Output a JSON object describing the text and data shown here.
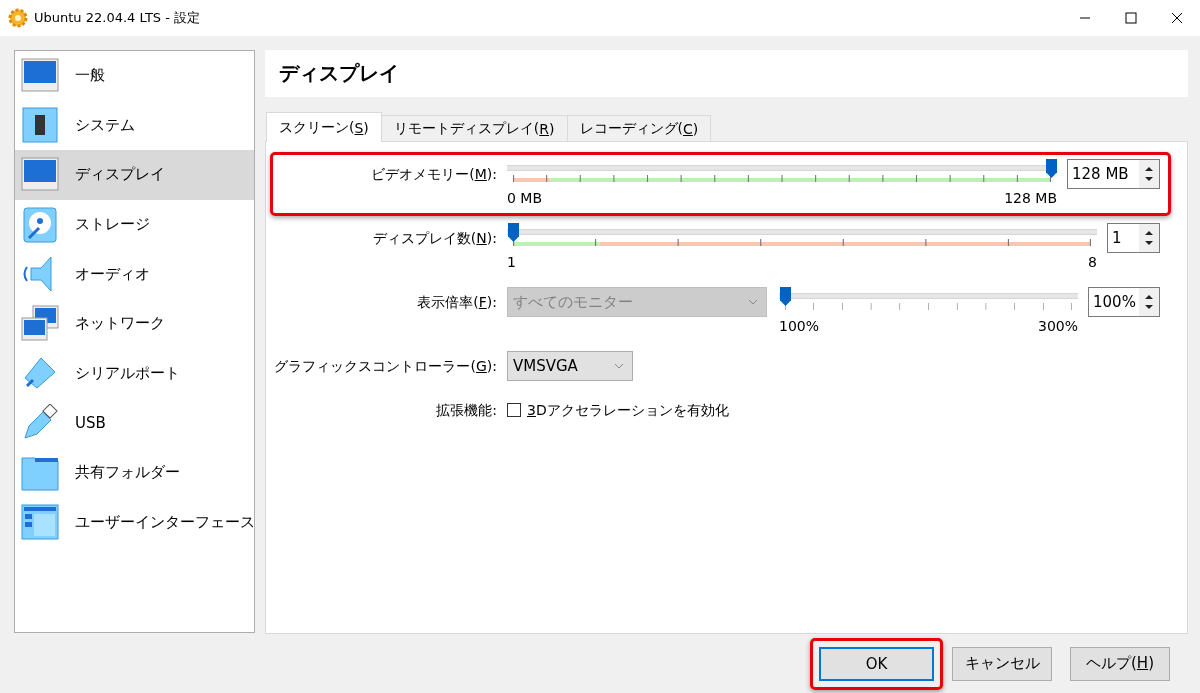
{
  "window": {
    "title": "Ubuntu 22.04.4 LTS - 設定"
  },
  "sidebar": {
    "items": [
      {
        "label": "一般",
        "kind": "general",
        "selected": false
      },
      {
        "label": "システム",
        "kind": "system",
        "selected": false
      },
      {
        "label": "ディスプレイ",
        "kind": "display",
        "selected": true
      },
      {
        "label": "ストレージ",
        "kind": "storage",
        "selected": false
      },
      {
        "label": "オーディオ",
        "kind": "audio",
        "selected": false
      },
      {
        "label": "ネットワーク",
        "kind": "network",
        "selected": false
      },
      {
        "label": "シリアルポート",
        "kind": "serial",
        "selected": false
      },
      {
        "label": "USB",
        "kind": "usb",
        "selected": false
      },
      {
        "label": "共有フォルダー",
        "kind": "folder",
        "selected": false
      },
      {
        "label": "ユーザーインターフェース",
        "kind": "ui",
        "selected": false
      }
    ]
  },
  "page": {
    "title": "ディスプレイ"
  },
  "tabs": [
    {
      "label": {
        "before": "スクリーン(",
        "key": "S",
        "after": ")"
      },
      "selected": true
    },
    {
      "label": {
        "before": "リモートディスプレイ(",
        "key": "R",
        "after": ")"
      },
      "selected": false
    },
    {
      "label": {
        "before": "レコーディング(",
        "key": "C",
        "after": ")"
      },
      "selected": false
    }
  ],
  "settings": [
    {
      "kind": "memory",
      "label": {
        "before": "ビデオメモリー(",
        "key": "M",
        "after": "):"
      },
      "level": 1,
      "value": "128 MB",
      "min_label": "0 MB",
      "max_label": "128 MB",
      "highlighted": true
    },
    {
      "kind": "count",
      "label": {
        "before": "ディスプレイ数(",
        "key": "N",
        "after": "):"
      },
      "level": 0,
      "value": "1",
      "min_label": "1",
      "max_label": "8",
      "highlighted": false
    },
    {
      "kind": "scale",
      "label": {
        "before": "表示倍率(",
        "key": "F",
        "after": "):"
      },
      "combo": {
        "value": "すべてのモニター",
        "disabled": true
      },
      "level": 0,
      "value": "100%",
      "min_label": "100%",
      "max_label": "300%",
      "highlighted": false
    },
    {
      "kind": "combo",
      "label": {
        "before": "グラフィックスコントローラー(",
        "key": "G",
        "after": "):"
      },
      "combo": {
        "value": "VMSVGA",
        "disabled": false
      },
      "highlighted": false
    },
    {
      "kind": "checkbox",
      "label": {
        "before": "拡張機能:"
      },
      "checkbox": {
        "label": {
          "key": "3",
          "after": "Dアクセラレーションを有効化"
        },
        "checked": false
      },
      "highlighted": false
    }
  ],
  "buttons": [
    {
      "label": {
        "before": "OK"
      },
      "default": true,
      "highlighted": true
    },
    {
      "label": {
        "before": "キャンセル"
      },
      "default": false,
      "highlighted": false
    },
    {
      "label": {
        "before": "ヘルプ(",
        "key": "H",
        "after": ")"
      },
      "default": false,
      "highlighted": false
    }
  ]
}
